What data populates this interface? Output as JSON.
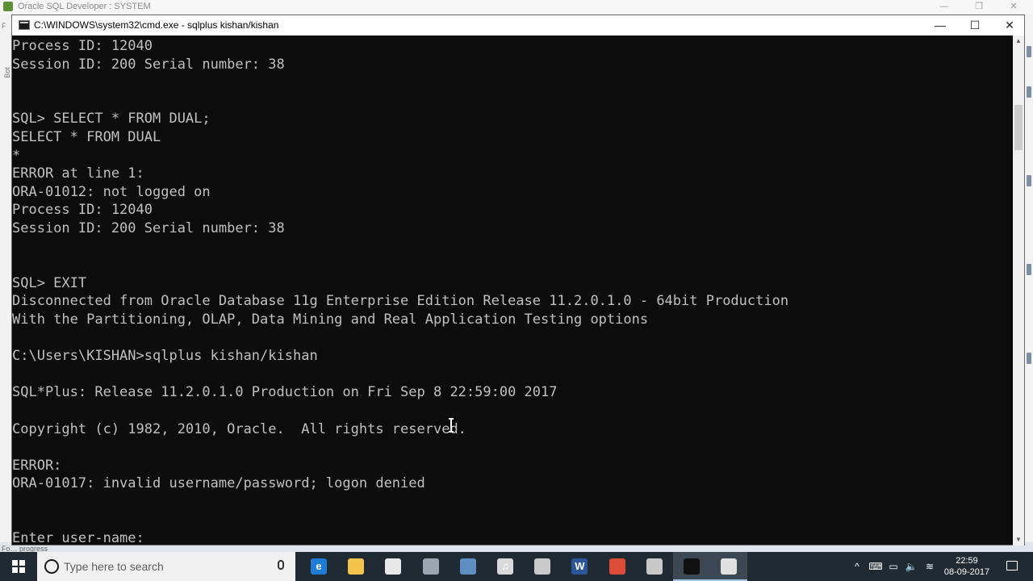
{
  "background_window": {
    "title": "Oracle SQL Developer : SYSTEM",
    "status_text": "Fo… progress",
    "left_labels": [
      "F",
      "Bot"
    ]
  },
  "cmd_window": {
    "title": "C:\\WINDOWS\\system32\\cmd.exe - sqlplus  kishan/kishan",
    "minimize": "—",
    "maximize": "☐",
    "close": "✕",
    "lines": [
      "Process ID: 12040",
      "Session ID: 200 Serial number: 38",
      "",
      "",
      "SQL> SELECT * FROM DUAL;",
      "SELECT * FROM DUAL",
      "*",
      "ERROR at line 1:",
      "ORA-01012: not logged on",
      "Process ID: 12040",
      "Session ID: 200 Serial number: 38",
      "",
      "",
      "SQL> EXIT",
      "Disconnected from Oracle Database 11g Enterprise Edition Release 11.2.0.1.0 - 64bit Production",
      "With the Partitioning, OLAP, Data Mining and Real Application Testing options",
      "",
      "C:\\Users\\KISHAN>sqlplus kishan/kishan",
      "",
      "SQL*Plus: Release 11.2.0.1.0 Production on Fri Sep 8 22:59:00 2017",
      "",
      "Copyright (c) 1982, 2010, Oracle.  All rights reserved.",
      "",
      "ERROR:",
      "ORA-01017: invalid username/password; logon denied",
      "",
      "",
      "Enter user-name:"
    ]
  },
  "taskbar": {
    "search_placeholder": "Type here to search",
    "apps": [
      {
        "name": "edge",
        "glyph": "e",
        "color": "#1e7bd6"
      },
      {
        "name": "file-explorer",
        "glyph": "",
        "color": "#f3c34b"
      },
      {
        "name": "store",
        "glyph": "",
        "color": "#e8e8e8"
      },
      {
        "name": "app-4",
        "glyph": "",
        "color": "#9aa7b3"
      },
      {
        "name": "app-5",
        "glyph": "",
        "color": "#5f8fc2"
      },
      {
        "name": "itunes",
        "glyph": "♫",
        "color": "#d9d9d9"
      },
      {
        "name": "app-7",
        "glyph": "",
        "color": "#c9c9c9"
      },
      {
        "name": "word",
        "glyph": "W",
        "color": "#2b579a"
      },
      {
        "name": "chrome",
        "glyph": "",
        "color": "#dd4b39"
      },
      {
        "name": "sql-developer",
        "glyph": "",
        "color": "#c8c8c8"
      },
      {
        "name": "cmd",
        "glyph": "",
        "color": "#111111"
      },
      {
        "name": "notepad",
        "glyph": "",
        "color": "#e0e0e0"
      }
    ],
    "time": "22:59",
    "date": "08-09-2017"
  }
}
